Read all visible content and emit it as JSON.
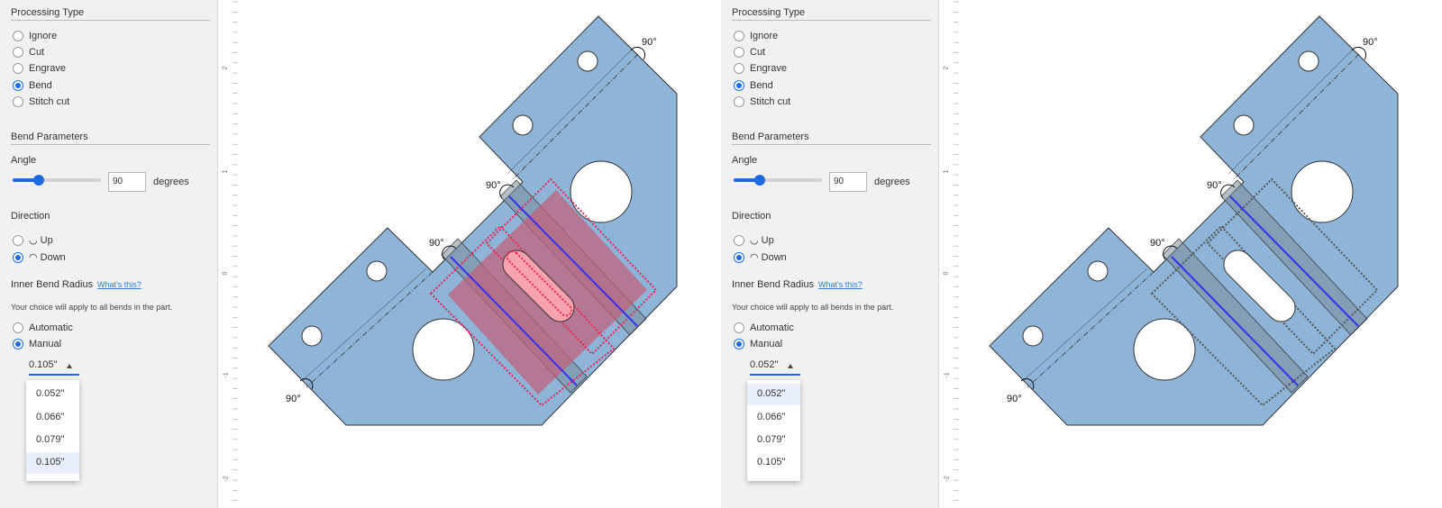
{
  "panels": [
    {
      "processing_title": "Processing Type",
      "processing_options": [
        "Ignore",
        "Cut",
        "Engrave",
        "Bend",
        "Stitch cut"
      ],
      "bend_params_title": "Bend Parameters",
      "angle_label": "Angle",
      "angle_value": "90",
      "angle_unit": "degrees",
      "angle_slider_fraction": 0.29,
      "direction_label": "Direction",
      "direction_up": "◡ Up",
      "direction_down": "◠ Down",
      "radius_label": "Inner Bend Radius",
      "radius_link": "What's this?",
      "radius_note": "Your choice will apply to all bends in the part.",
      "mode_automatic": "Automatic",
      "mode_manual": "Manual",
      "select_value": "0.105\"",
      "options": [
        "0.052\"",
        "0.066\"",
        "0.079\"",
        "0.105\""
      ]
    },
    {
      "processing_title": "Processing Type",
      "processing_options": [
        "Ignore",
        "Cut",
        "Engrave",
        "Bend",
        "Stitch cut"
      ],
      "bend_params_title": "Bend Parameters",
      "angle_label": "Angle",
      "angle_value": "90",
      "angle_unit": "degrees",
      "angle_slider_fraction": 0.29,
      "direction_label": "Direction",
      "direction_up": "◡ Up",
      "direction_down": "◠ Down",
      "radius_label": "Inner Bend Radius",
      "radius_link": "What's this?",
      "radius_note": "Your choice will apply to all bends in the part.",
      "mode_automatic": "Automatic",
      "mode_manual": "Manual",
      "select_value": "0.052\"",
      "options": [
        "0.052\"",
        "0.066\"",
        "0.079\"",
        "0.105\""
      ]
    }
  ],
  "ruler_labels": [
    "2",
    "1",
    "0",
    "-1",
    "-2"
  ],
  "bend_angle_label": "90°",
  "colors": {
    "part_fill": "#8eb4d8",
    "part_stroke": "#333333",
    "bend_line": "#3a2ff0",
    "selection_fill": "#c4607a",
    "selection_outline": "#ee2255",
    "hover_outline": "#555555",
    "accent": "#1b6ce0"
  }
}
